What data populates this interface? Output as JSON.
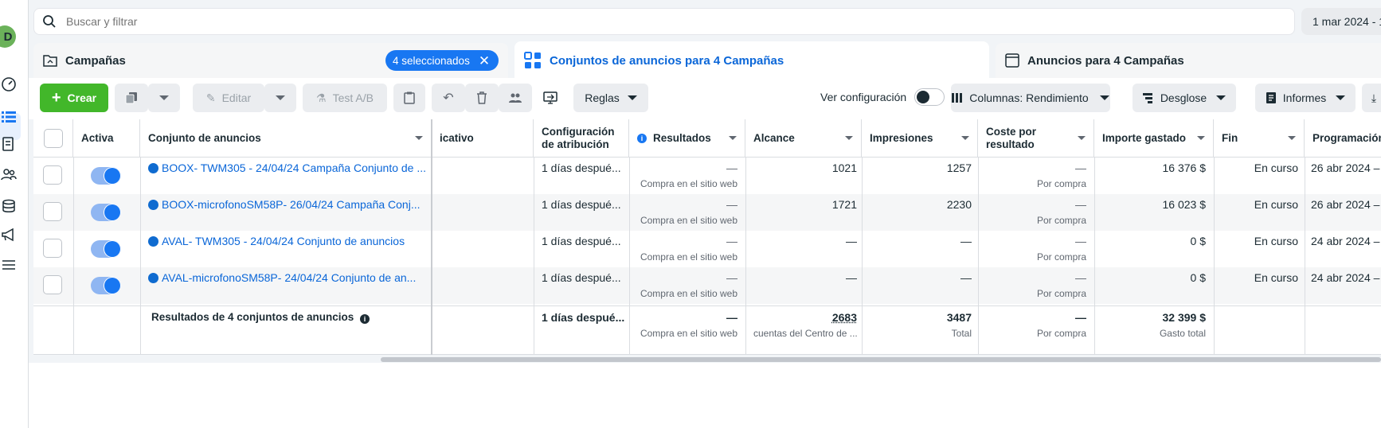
{
  "search": {
    "placeholder": "Buscar y filtrar"
  },
  "date_range": "1 mar 2024 - 1",
  "avatar_letter": "D",
  "tabs": {
    "campaigns": "Campañas",
    "selected_badge": "4 seleccionados",
    "adsets": "Conjuntos de anuncios para 4 Campañas",
    "ads": "Anuncios para 4 Campañas"
  },
  "toolbar": {
    "create": "Crear",
    "edit": "Editar",
    "test": "Test A/B",
    "rules": "Reglas",
    "view_settings": "Ver configuración",
    "columns": "Columnas: Rendimiento",
    "breakdown": "Desglose",
    "reports": "Informes"
  },
  "columns": {
    "active": "Activa",
    "adset": "Conjunto de anuncios",
    "delivery": "icativo",
    "attribution": "Configuración de atribución",
    "results": "Resultados",
    "reach": "Alcance",
    "impressions": "Impresiones",
    "cost_per_result": "Coste por resultado",
    "amount_spent": "Importe gastado",
    "end": "Fin",
    "schedule": "Programación"
  },
  "rows": [
    {
      "name": "BOOX- TWM305 - 24/04/24 Campaña Conjunto de ...",
      "attribution": "1 días despué...",
      "results": "—",
      "results_sub": "Compra en el sitio web",
      "reach": "1021",
      "impressions": "1257",
      "cpr": "—",
      "cpr_sub": "Por compra",
      "spent": "16 376 $",
      "end": "En curso",
      "schedule": "26 abr 2024 –"
    },
    {
      "name": "BOOX-microfonoSM58P- 26/04/24 Campaña Conj...",
      "attribution": "1 días despué...",
      "results": "—",
      "results_sub": "Compra en el sitio web",
      "reach": "1721",
      "impressions": "2230",
      "cpr": "—",
      "cpr_sub": "Por compra",
      "spent": "16 023 $",
      "end": "En curso",
      "schedule": "26 abr 2024 –"
    },
    {
      "name": "AVAL- TWM305 - 24/04/24 Conjunto de anuncios",
      "attribution": "1 días despué...",
      "results": "—",
      "results_sub": "Compra en el sitio web",
      "reach": "—",
      "impressions": "—",
      "cpr": "—",
      "cpr_sub": "Por compra",
      "spent": "0 $",
      "end": "En curso",
      "schedule": "24 abr 2024 –"
    },
    {
      "name": "AVAL-microfonoSM58P- 24/04/24 Conjunto de an...",
      "attribution": "1 días despué...",
      "results": "—",
      "results_sub": "Compra en el sitio web",
      "reach": "—",
      "impressions": "—",
      "cpr": "—",
      "cpr_sub": "Por compra",
      "spent": "0 $",
      "end": "En curso",
      "schedule": "24 abr 2024 –"
    }
  ],
  "totals": {
    "label": "Resultados de 4 conjuntos de anuncios",
    "attribution": "1 días despué...",
    "results": "—",
    "results_sub": "Compra en el sitio web",
    "reach": "2683",
    "reach_sub": "cuentas del Centro de ...",
    "impressions": "3487",
    "impressions_sub": "Total",
    "cpr": "—",
    "cpr_sub": "Por compra",
    "spent": "32 399 $",
    "spent_sub": "Gasto total"
  },
  "colors": {
    "accent": "#1877f2",
    "create": "#42b72a"
  }
}
